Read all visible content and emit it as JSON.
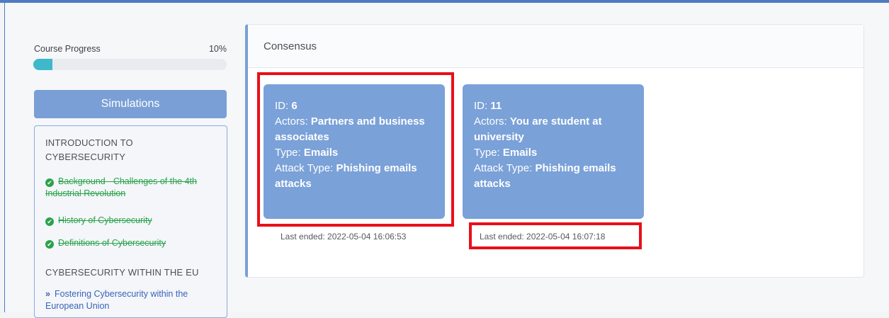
{
  "sidebar": {
    "progress_label": "Course Progress",
    "progress_percent": "10%",
    "progress_value": 0.1,
    "simulations_label": "Simulations",
    "sections": [
      {
        "title": "INTRODUCTION TO CYBERSECURITY",
        "lessons": [
          {
            "label": "Background - Challenges of the 4th Industrial Revolution",
            "status": "completed"
          },
          {
            "label": "History of Cybersecurity",
            "status": "completed"
          },
          {
            "label": "Definitions of Cybersecurity",
            "status": "completed"
          }
        ]
      },
      {
        "title": "CYBERSECURITY WITHIN THE EU",
        "lessons": [
          {
            "label": "Fostering Cybersecurity within the European Union",
            "status": "link"
          }
        ]
      }
    ]
  },
  "main": {
    "title": "Consensus",
    "cards": [
      {
        "id_label": "ID:",
        "id": "6",
        "actors_label": "Actors:",
        "actors": "Partners and business associates",
        "type_label": "Type:",
        "type": "Emails",
        "attack_label": "Attack Type:",
        "attack_type": "Phishing emails attacks",
        "last_ended": "Last ended: 2022-05-04 16:06:53"
      },
      {
        "id_label": "ID:",
        "id": "11",
        "actors_label": "Actors:",
        "actors": "You are student at university",
        "type_label": "Type:",
        "type": "Emails",
        "attack_label": "Attack Type:",
        "attack_type": "Phishing emails attacks",
        "last_ended": "Last ended: 2022-05-04 16:07:18"
      }
    ]
  },
  "colors": {
    "accent": "#7a9fd6",
    "progress": "#3db9cb",
    "completed": "#2aa24a",
    "highlight": "#e8101a"
  }
}
